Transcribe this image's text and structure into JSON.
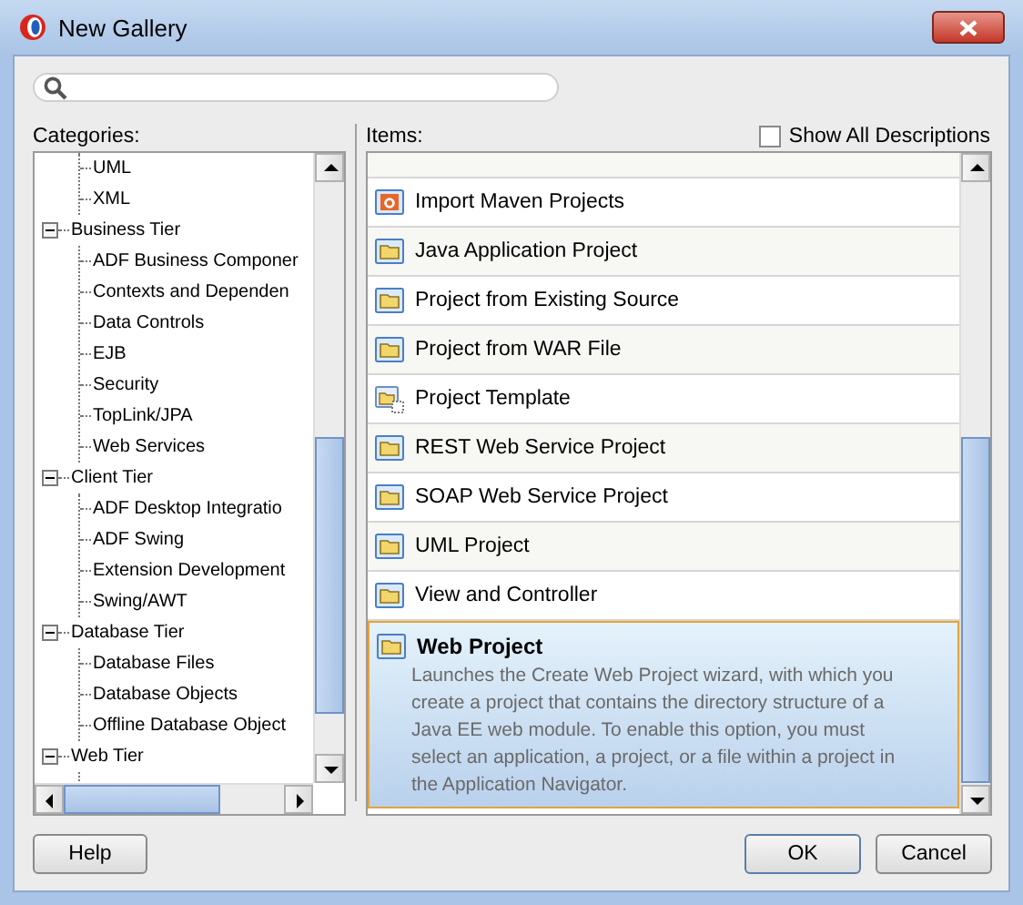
{
  "window": {
    "title": "New Gallery"
  },
  "categories": {
    "label": "Categories:",
    "tree": [
      {
        "children": [
          {
            "label": "UML"
          },
          {
            "label": "XML"
          }
        ]
      },
      {
        "label": "Business Tier",
        "expanded": true,
        "children": [
          {
            "label": "ADF Business Componer"
          },
          {
            "label": "Contexts and Dependen"
          },
          {
            "label": "Data Controls"
          },
          {
            "label": "EJB"
          },
          {
            "label": "Security"
          },
          {
            "label": "TopLink/JPA"
          },
          {
            "label": "Web Services"
          }
        ]
      },
      {
        "label": "Client Tier",
        "expanded": true,
        "children": [
          {
            "label": "ADF Desktop Integratio"
          },
          {
            "label": "ADF Swing"
          },
          {
            "label": "Extension Development"
          },
          {
            "label": "Swing/AWT"
          }
        ]
      },
      {
        "label": "Database Tier",
        "expanded": true,
        "children": [
          {
            "label": "Database Files"
          },
          {
            "label": "Database Objects"
          },
          {
            "label": "Offline Database Object"
          }
        ]
      },
      {
        "label": "Web Tier",
        "expanded": true
      }
    ]
  },
  "items": {
    "label": "Items:",
    "show_all_descriptions": {
      "label": "Show All Descriptions",
      "checked": false
    },
    "list": [
      {
        "label": "Import Maven Projects",
        "kind": "maven",
        "selected": false
      },
      {
        "label": "Java Application Project",
        "kind": "folder",
        "selected": false
      },
      {
        "label": "Project from Existing Source",
        "kind": "folder",
        "selected": false
      },
      {
        "label": "Project from WAR File",
        "kind": "folder",
        "selected": false
      },
      {
        "label": "Project Template",
        "kind": "template",
        "selected": false
      },
      {
        "label": "REST Web Service Project",
        "kind": "folder",
        "selected": false
      },
      {
        "label": "SOAP Web Service Project",
        "kind": "folder",
        "selected": false
      },
      {
        "label": "UML Project",
        "kind": "folder",
        "selected": false
      },
      {
        "label": "View and Controller",
        "kind": "folder",
        "selected": false
      },
      {
        "label": "Web Project",
        "kind": "folder",
        "selected": true,
        "description": "Launches the Create Web Project wizard, with which you create a project that contains the directory structure of a Java EE web module. To enable this option, you must select an application, a project, or a file within a project in the Application Navigator."
      }
    ]
  },
  "buttons": {
    "help": "Help",
    "ok": "OK",
    "cancel": "Cancel"
  }
}
